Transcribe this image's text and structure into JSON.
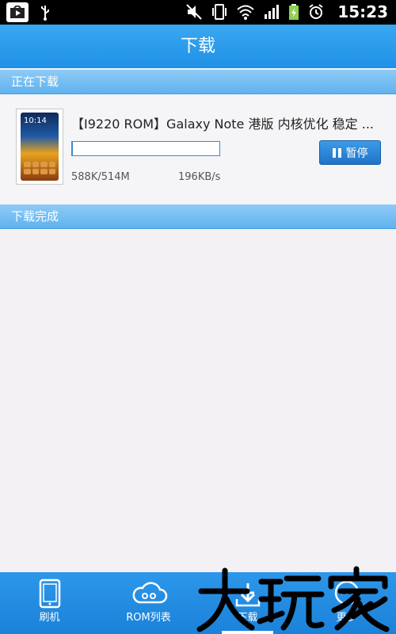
{
  "status_bar": {
    "time": "15:23",
    "icons": [
      "play-store-icon",
      "usb-icon",
      "mute-icon",
      "vibrate-icon",
      "wifi-icon",
      "signal-icon",
      "battery-icon",
      "alarm-icon"
    ]
  },
  "header": {
    "title": "下载"
  },
  "sections": {
    "downloading": "正在下载",
    "completed": "下载完成"
  },
  "download_item": {
    "title": "【I9220 ROM】Galaxy Note 港版 内核优化 稳定 ...",
    "progress_fraction": 0.0011,
    "size": "588K/514M",
    "speed": "196KB/s",
    "pause_label": "暂停"
  },
  "bottom_nav": {
    "items": [
      {
        "label": "刷机",
        "icon": "phone-icon"
      },
      {
        "label": "ROM列表",
        "icon": "cloud-icon"
      },
      {
        "label": "下载",
        "icon": "download-icon",
        "active": true
      },
      {
        "label": "更多",
        "icon": "more-icon"
      }
    ]
  },
  "watermark": {
    "text": "大玩家"
  },
  "colors": {
    "title_bar": "#1e90e6",
    "section_header": "#5fb2ee",
    "pause_button": "#1f73c7",
    "background": "#f3f1f4"
  }
}
